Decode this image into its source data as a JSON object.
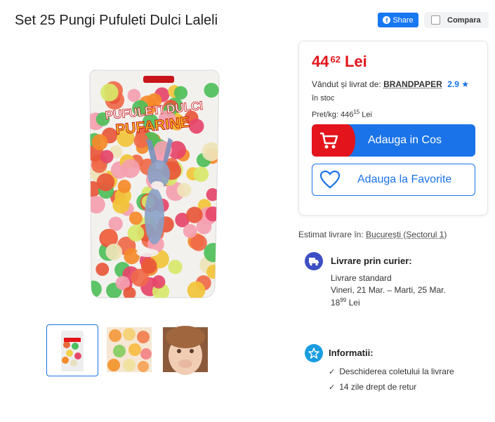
{
  "product": {
    "title": "Set 25 Pungi Pufuleti Dulci Laleli",
    "package_text_line1": "PUFULETI DULCI",
    "package_text_line2": "PUFARINE"
  },
  "actions": {
    "share_label": "Share",
    "compare_label": "Compara"
  },
  "offer": {
    "price_int": "44",
    "price_dec": "62",
    "currency": "Lei",
    "sold_prefix": "Vândut și livrat de:",
    "seller": "BRANDPAPER",
    "seller_rating": "2.9",
    "stock": "în stoc",
    "unit_price_prefix": "Pret/kg: 446",
    "unit_price_dec": "15",
    "unit_price_currency": "Lei",
    "add_to_cart_label": "Adauga in Cos",
    "add_to_fav_label": "Adauga la Favorite"
  },
  "delivery": {
    "estimate_prefix": "Estimat livrare în:",
    "location": "București (Sectorul 1)",
    "courier_title": "Livrare prin curier:",
    "method": "Livrare standard",
    "dates": "Vineri, 21 Mar. – Marti, 25 Mar.",
    "cost_int": "18",
    "cost_dec": "99",
    "cost_currency": "Lei"
  },
  "info": {
    "title": "Informatii:",
    "items": [
      "Deschiderea coletului la livrare",
      "14 zile drept de retur"
    ]
  },
  "colors": {
    "price_red": "#e3141b",
    "primary_blue": "#1a73e8",
    "facebook_blue": "#1877f2",
    "courier_icon_bg": "#3d4fc4",
    "info_icon_bg": "#1a9de0"
  },
  "icons": {
    "share": "facebook-icon",
    "compare": "checkbox-icon",
    "cart": "cart-icon",
    "favorite": "heart-icon",
    "courier": "truck-icon",
    "info": "star-badge-icon",
    "rating": "star-icon",
    "check": "check-icon"
  }
}
